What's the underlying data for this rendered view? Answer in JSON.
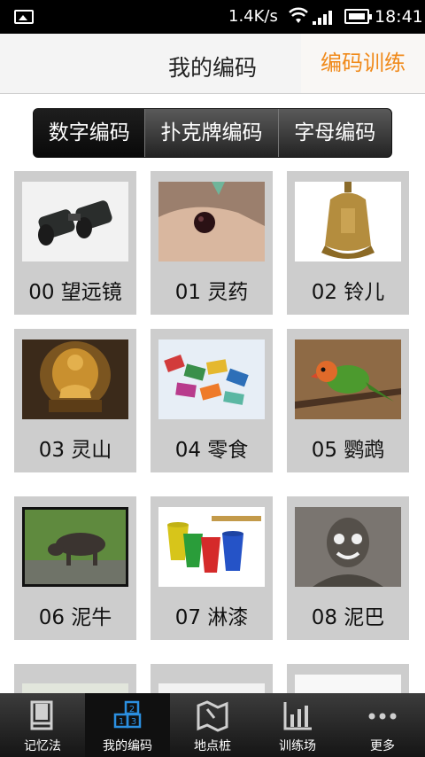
{
  "status": {
    "speed": "1.4K/s",
    "time": "18:41"
  },
  "header": {
    "title": "我的编码",
    "action": "编码训练"
  },
  "segments": [
    {
      "label": "数字编码",
      "active": true
    },
    {
      "label": "扑克牌编码",
      "active": false
    },
    {
      "label": "字母编码",
      "active": false
    }
  ],
  "items": [
    {
      "label": "00 望远镜"
    },
    {
      "label": "01 灵药"
    },
    {
      "label": "02 铃儿"
    },
    {
      "label": "03 灵山"
    },
    {
      "label": "04 零食"
    },
    {
      "label": "05 鹦鹉"
    },
    {
      "label": "06 泥牛"
    },
    {
      "label": "07 淋漆"
    },
    {
      "label": "08 泥巴"
    }
  ],
  "tabs": [
    {
      "label": "记忆法",
      "icon": "book-icon"
    },
    {
      "label": "我的编码",
      "icon": "number-blocks-icon"
    },
    {
      "label": "地点桩",
      "icon": "map-icon"
    },
    {
      "label": "训练场",
      "icon": "chart-icon"
    },
    {
      "label": "更多",
      "icon": "more-dots-icon"
    }
  ],
  "colors": {
    "accent": "#f08a1b",
    "active_tab_icon": "#2b8fe0"
  }
}
